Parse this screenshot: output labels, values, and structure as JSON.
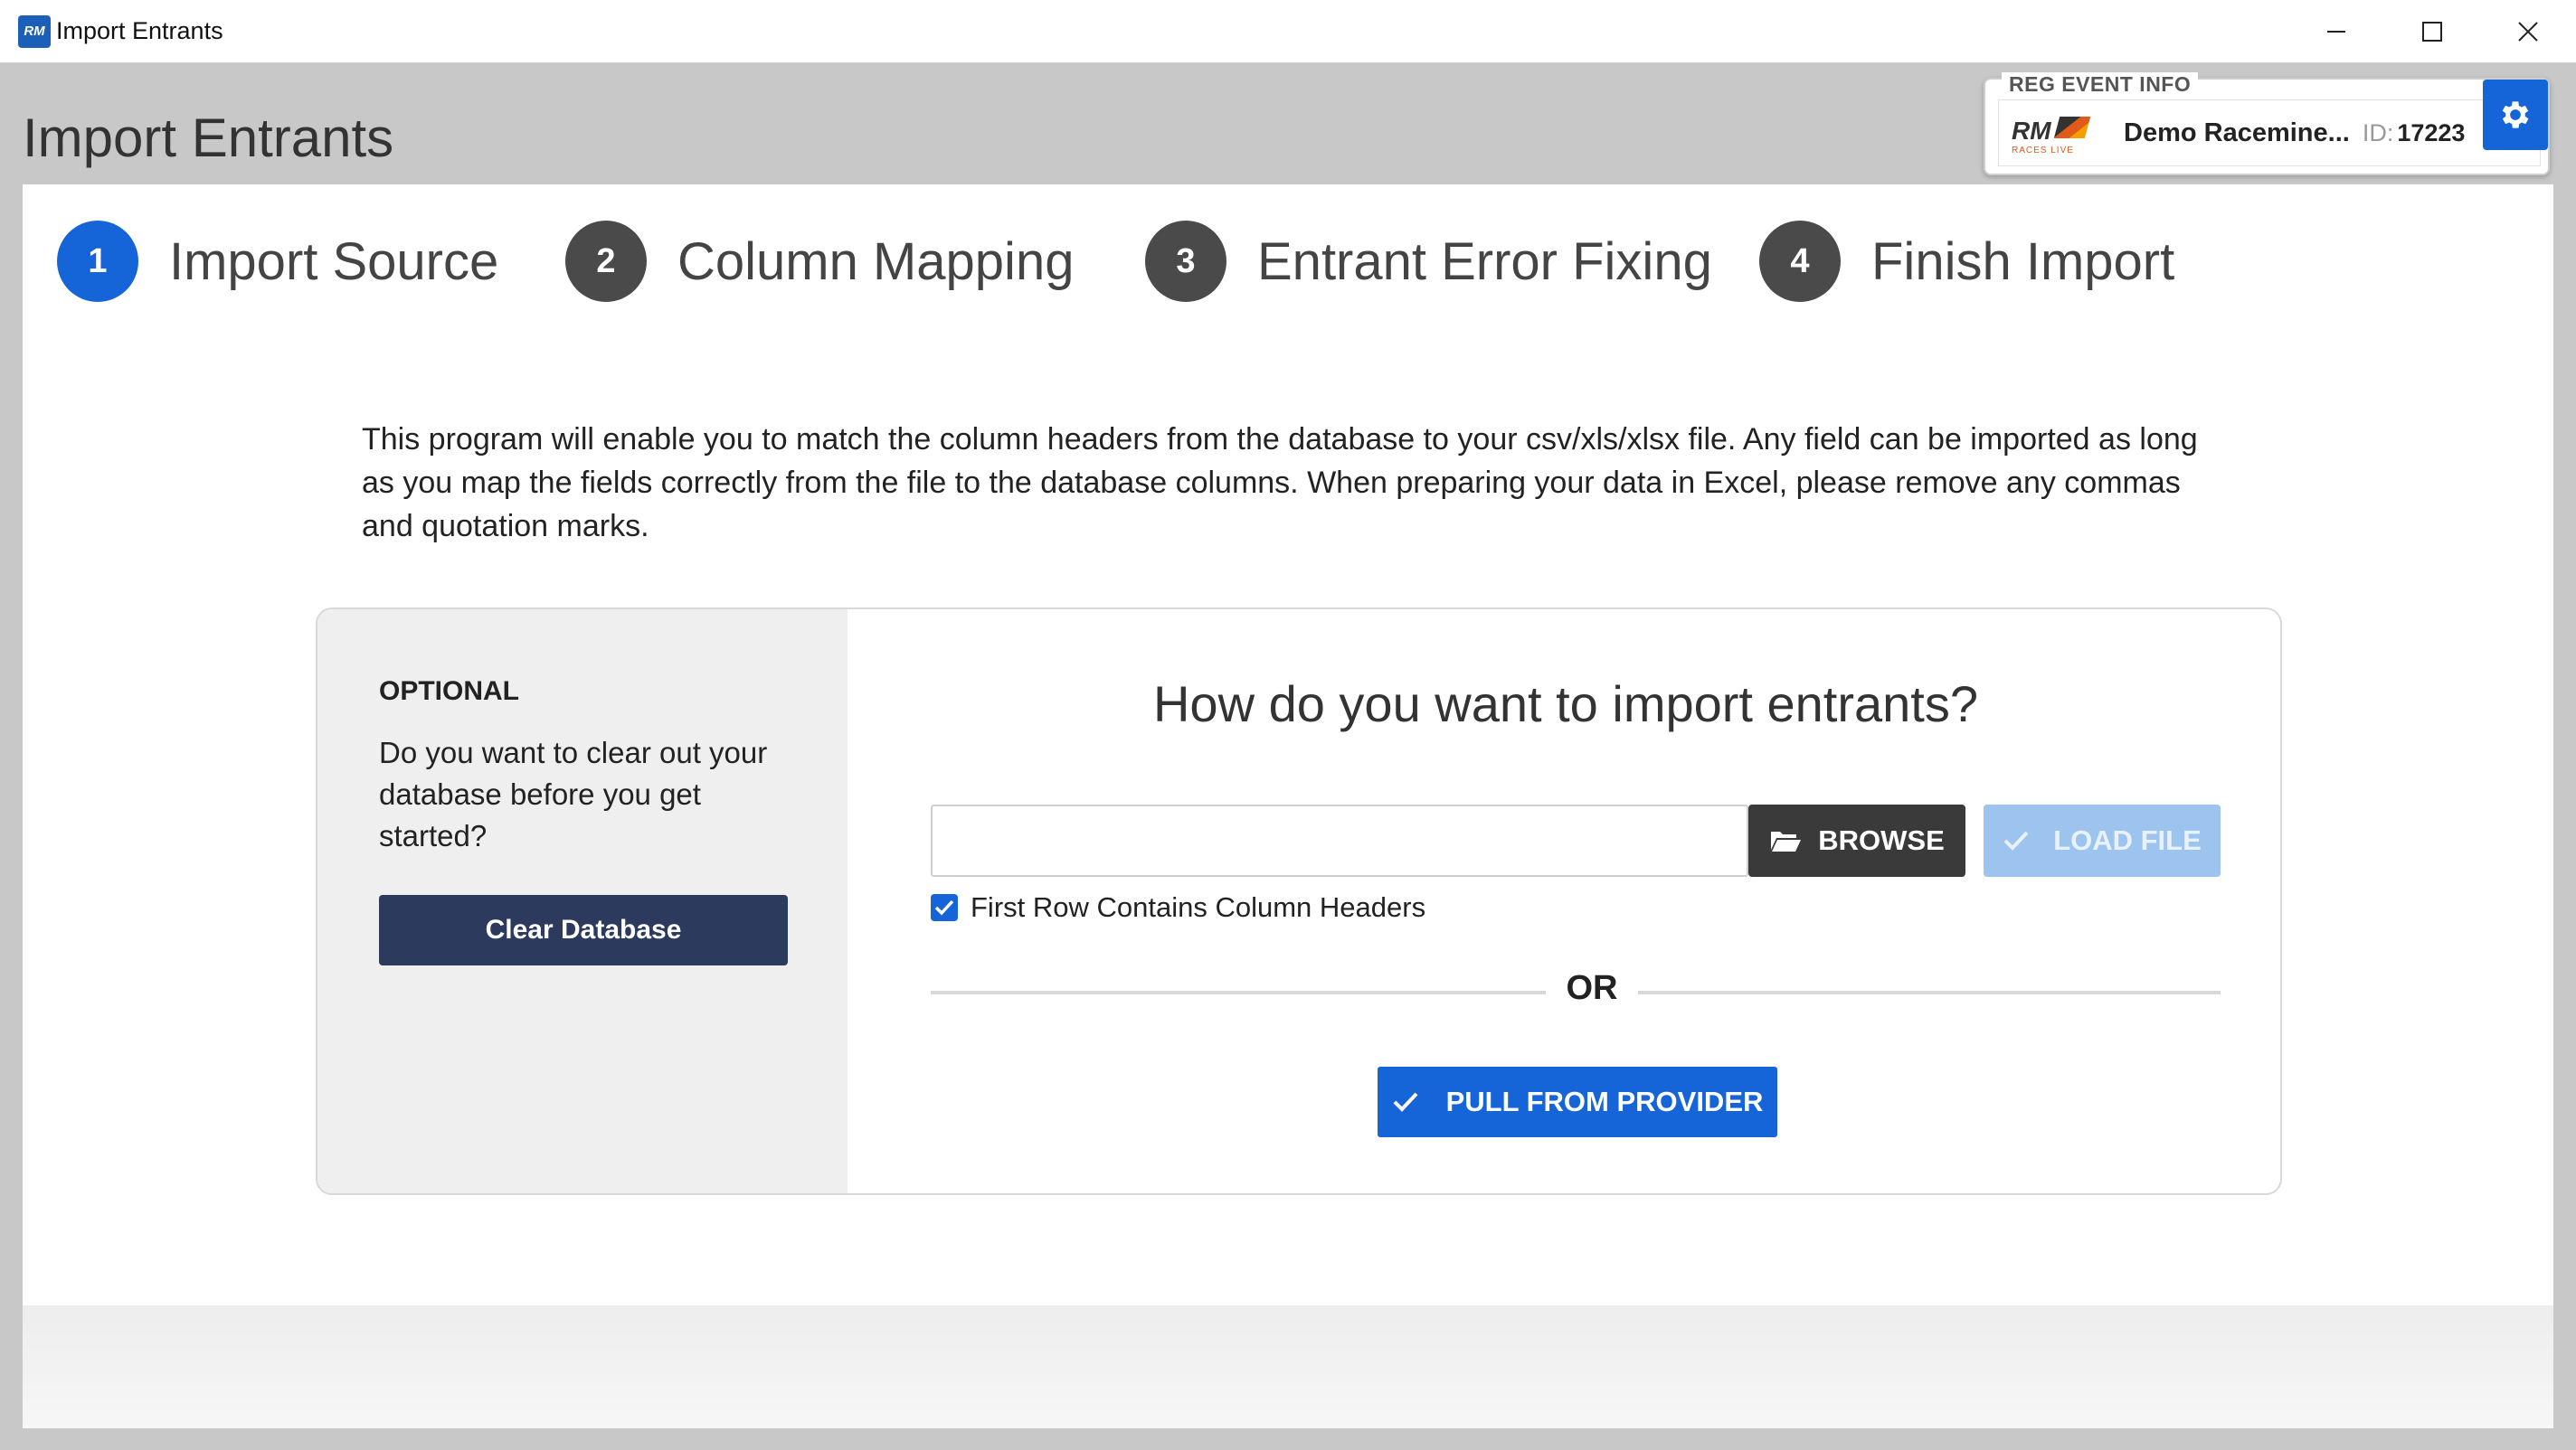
{
  "window": {
    "title": "Import Entrants",
    "icon": "rm-app-icon",
    "controls": [
      "minimize-icon",
      "maximize-icon",
      "close-icon"
    ]
  },
  "header": {
    "page_title": "Import Entrants"
  },
  "reg_event": {
    "label": "REG EVENT INFO",
    "logo_text": "RM",
    "logo_sub": "RACES LIVE",
    "event_name": "Demo Racemine...",
    "id_label": "ID:",
    "id_value": "17223",
    "settings_icon": "gear-icon"
  },
  "steps": [
    {
      "number": "1",
      "label": "Import Source",
      "active": true
    },
    {
      "number": "2",
      "label": "Column Mapping",
      "active": false
    },
    {
      "number": "3",
      "label": "Entrant Error Fixing",
      "active": false
    },
    {
      "number": "4",
      "label": "Finish Import",
      "active": false
    }
  ],
  "description": "This program will enable you to match the column headers from the database to your csv/xls/xlsx file. Any field can be imported as long as you map the fields correctly from the file to the database columns. When preparing your data in Excel, please remove any commas and quotation marks.",
  "optional": {
    "label": "OPTIONAL",
    "text": "Do you want to clear out your database before you get started?",
    "clear_button": "Clear Database"
  },
  "import": {
    "heading": "How do you want to import entrants?",
    "file_value": "",
    "browse_label": "BROWSE",
    "load_label": "LOAD FILE",
    "checkbox_label": "First Row Contains Column Headers",
    "checkbox_checked": true,
    "or_text": "OR",
    "pull_label": "PULL FROM PROVIDER"
  },
  "colors": {
    "accent": "#1565d8",
    "dark_button": "#3a3a3a",
    "clear_button": "#2c3a5e",
    "disabled_button": "#9cc4ef"
  }
}
